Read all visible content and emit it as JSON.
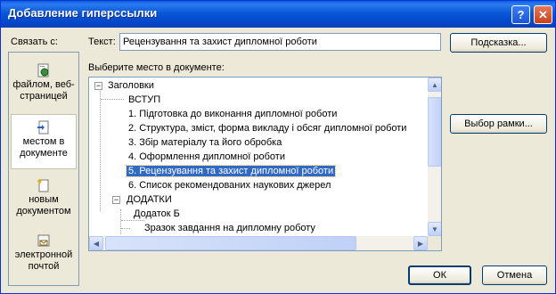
{
  "window": {
    "title": "Добавление гиперссылки"
  },
  "link_with": {
    "label": "Связать с:",
    "items": [
      {
        "label": "файлом, веб-страницей",
        "icon": "file-web-icon"
      },
      {
        "label": "местом в документе",
        "icon": "document-place-icon"
      },
      {
        "label": "новым документом",
        "icon": "new-document-icon"
      },
      {
        "label": "электронной почтой",
        "icon": "email-icon"
      }
    ]
  },
  "text_field": {
    "label": "Текст:",
    "value": "Рецензування та захист дипломної роботи"
  },
  "buttons": {
    "hint": "Подсказка...",
    "frame": "Выбор рамки...",
    "ok": "ОК",
    "cancel": "Отмена"
  },
  "place": {
    "label": "Выберите место в документе:",
    "tree": [
      {
        "text": "Заголовки",
        "level": 0,
        "expander": "−"
      },
      {
        "text": "ВСТУП",
        "level": 1
      },
      {
        "text": "1. Підготовка до виконання дипломної роботи",
        "level": 1
      },
      {
        "text": "2. Структура, зміст, форма викладу і обсяг дипломної роботи",
        "level": 1
      },
      {
        "text": "3. Збір матеріалу та його обробка",
        "level": 1
      },
      {
        "text": "4. Оформлення дипломної роботи",
        "level": 1
      },
      {
        "text": "5. Рецензування та захист дипломної роботи",
        "level": 1,
        "selected": true
      },
      {
        "text": "6. Список рекомендованих наукових джерел",
        "level": 1
      },
      {
        "text": "ДОДАТКИ",
        "level": 1,
        "expander": "−"
      },
      {
        "text": "Додаток Б",
        "level": 2
      },
      {
        "text": "Зразок завдання на дипломну роботу",
        "level": 2
      }
    ]
  },
  "colors": {
    "titlebar": "#0a58d8",
    "selection": "#316ac5",
    "dialog": "#ece9d8"
  }
}
